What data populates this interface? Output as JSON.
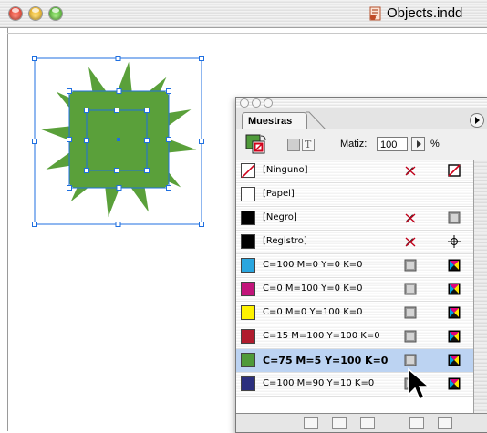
{
  "window": {
    "title": "Objects.indd"
  },
  "palette": {
    "tab_label": "Muestras",
    "tint_label": "Matiz:",
    "tint_value": "100",
    "tint_unit": "%",
    "colors": {
      "selection_blue": "#1f6fe0",
      "art_green": "#5aa03a"
    },
    "swatches": [
      {
        "name": "[Ninguno]",
        "color": "none",
        "icon1": "no-edit-pencil",
        "icon2": "none-square"
      },
      {
        "name": "[Papel]",
        "color": "#ffffff",
        "icon1": "",
        "icon2": ""
      },
      {
        "name": "[Negro]",
        "color": "#000000",
        "icon1": "no-edit-pencil",
        "icon2": "process-gray"
      },
      {
        "name": "[Registro]",
        "color": "#000000",
        "icon1": "no-edit-pencil",
        "icon2": "registration-target"
      },
      {
        "name": "C=100 M=0 Y=0 K=0",
        "color": "#2aa6df",
        "icon1": "process-gray",
        "icon2": "cmyk"
      },
      {
        "name": "C=0 M=100 Y=0 K=0",
        "color": "#c2147a",
        "icon1": "process-gray",
        "icon2": "cmyk"
      },
      {
        "name": "C=0 M=0 Y=100 K=0",
        "color": "#fff200",
        "icon1": "process-gray",
        "icon2": "cmyk"
      },
      {
        "name": "C=15 M=100 Y=100 K=0",
        "color": "#b01c2e",
        "icon1": "process-gray",
        "icon2": "cmyk"
      },
      {
        "name": "C=75 M=5 Y=100 K=0",
        "color": "#4f9a3a",
        "icon1": "process-gray",
        "icon2": "cmyk",
        "selected": true
      },
      {
        "name": "C=100 M=90 Y=10 K=0",
        "color": "#2b2f7e",
        "icon1": "process-gray",
        "icon2": "cmyk"
      }
    ]
  }
}
